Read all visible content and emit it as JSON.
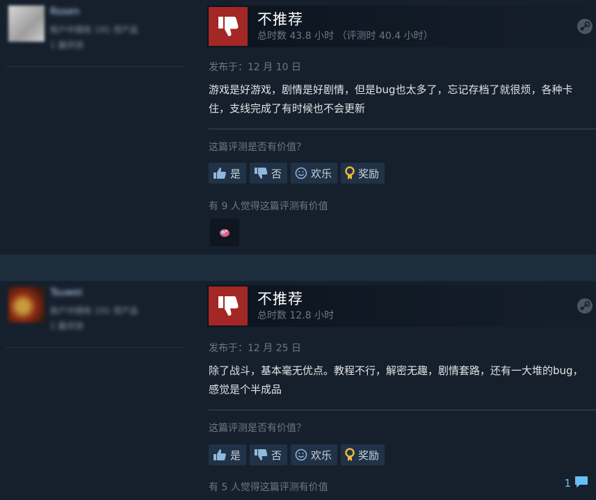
{
  "reviews": [
    {
      "author_name": "Rosen",
      "author_line1": "账户中拥有 191 项产品",
      "author_line2": "1 篇评测",
      "verdict": "不推荐",
      "hours": "总时数 43.8 小时 （评测时 40.4 小时）",
      "posted": "发布于：12 月 10 日",
      "body": "游戏是好游戏，剧情是好剧情，但是bug也太多了，忘记存档了就很烦，各种卡住，支线完成了有时候也不会更新",
      "helpful_question": "这篇评测是否有价值？",
      "buttons": {
        "yes": "是",
        "no": "否",
        "funny": "欢乐",
        "award": "奖励"
      },
      "helpful_count": "有 9 人觉得这篇评测有价值"
    },
    {
      "author_name": "Tsuwei",
      "author_line1": "账户中拥有 191 项产品",
      "author_line2": "1 篇评测",
      "verdict": "不推荐",
      "hours": "总时数 12.8 小时",
      "posted": "发布于：12 月 25 日",
      "body": "除了战斗，基本毫无优点。教程不行，解密无趣，剧情套路，还有一大堆的bug，感觉是个半成品",
      "helpful_question": "这篇评测是否有价值？",
      "buttons": {
        "yes": "是",
        "no": "否",
        "funny": "欢乐",
        "award": "奖励"
      },
      "helpful_count": "有 5 人觉得这篇评测有价值",
      "comment_count": "1"
    }
  ],
  "icons": [
    "thumbs-down-icon",
    "steam-logo-icon",
    "thumbs-up-icon",
    "smiley-icon",
    "award-medal-icon",
    "award-emote-icon",
    "comment-icon"
  ],
  "colors": {
    "thumb_box": "#a32725",
    "link": "#66c0f4",
    "background": "#16202d"
  }
}
